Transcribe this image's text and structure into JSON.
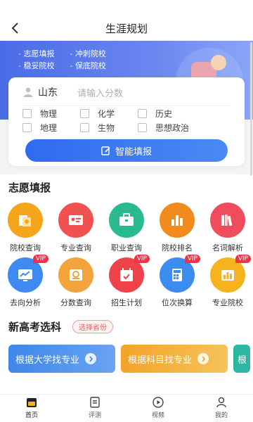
{
  "header": {
    "title": "生涯规划"
  },
  "banner": {
    "tags": [
      [
        "志愿填报",
        "冲刺院校"
      ],
      [
        "稳妥院校",
        "保底院校"
      ]
    ]
  },
  "form": {
    "province": "山东",
    "score_placeholder": "请输入分数",
    "subjects": [
      "物理",
      "化学",
      "历史",
      "地理",
      "生物",
      "思想政治"
    ],
    "submit_label": "智能填报"
  },
  "volunteer": {
    "title": "志愿填报",
    "items": [
      {
        "label": "院校查询",
        "icon": "school-card-icon",
        "color": "#f4a51c",
        "vip": ""
      },
      {
        "label": "专业查询",
        "icon": "id-card-icon",
        "color": "#f0524f",
        "vip": ""
      },
      {
        "label": "职业查询",
        "icon": "briefcase-icon",
        "color": "#2bb98f",
        "vip": ""
      },
      {
        "label": "院校排名",
        "icon": "bar-chart-icon",
        "color": "#f28a1d",
        "vip": ""
      },
      {
        "label": "名词解析",
        "icon": "books-icon",
        "color": "#ef4c5c",
        "vip": ""
      },
      {
        "label": "去向分析",
        "icon": "trend-screen-icon",
        "color": "#3d8bf2",
        "vip": "VIP"
      },
      {
        "label": "分数查询",
        "icon": "score-card-icon",
        "color": "#f2a33c",
        "vip": ""
      },
      {
        "label": "招生计划",
        "icon": "calendar-check-icon",
        "color": "#f0424a",
        "vip": "VIP"
      },
      {
        "label": "位次换算",
        "icon": "calculator-icon",
        "color": "#3c8cf0",
        "vip": "VIP"
      },
      {
        "label": "专业院校",
        "icon": "column-chart-icon",
        "color": "#f5b41e",
        "vip": "VIP"
      }
    ]
  },
  "xuanke": {
    "title": "新高考选科",
    "chip": "选择省份",
    "cards": [
      {
        "label": "根据大学找专业",
        "color": "#3e86e8"
      },
      {
        "label": "根据科目找专业",
        "color": "#f2a328"
      },
      {
        "label": "根",
        "color": "#2fb6a2"
      }
    ]
  },
  "nav": [
    {
      "label": "首页",
      "icon": "home-icon"
    },
    {
      "label": "评测",
      "icon": "assessment-icon"
    },
    {
      "label": "视频",
      "icon": "video-icon"
    },
    {
      "label": "我的",
      "icon": "profile-icon"
    }
  ],
  "colors": {
    "primary": "#2f6bf0",
    "banner": "#5a78ec"
  }
}
